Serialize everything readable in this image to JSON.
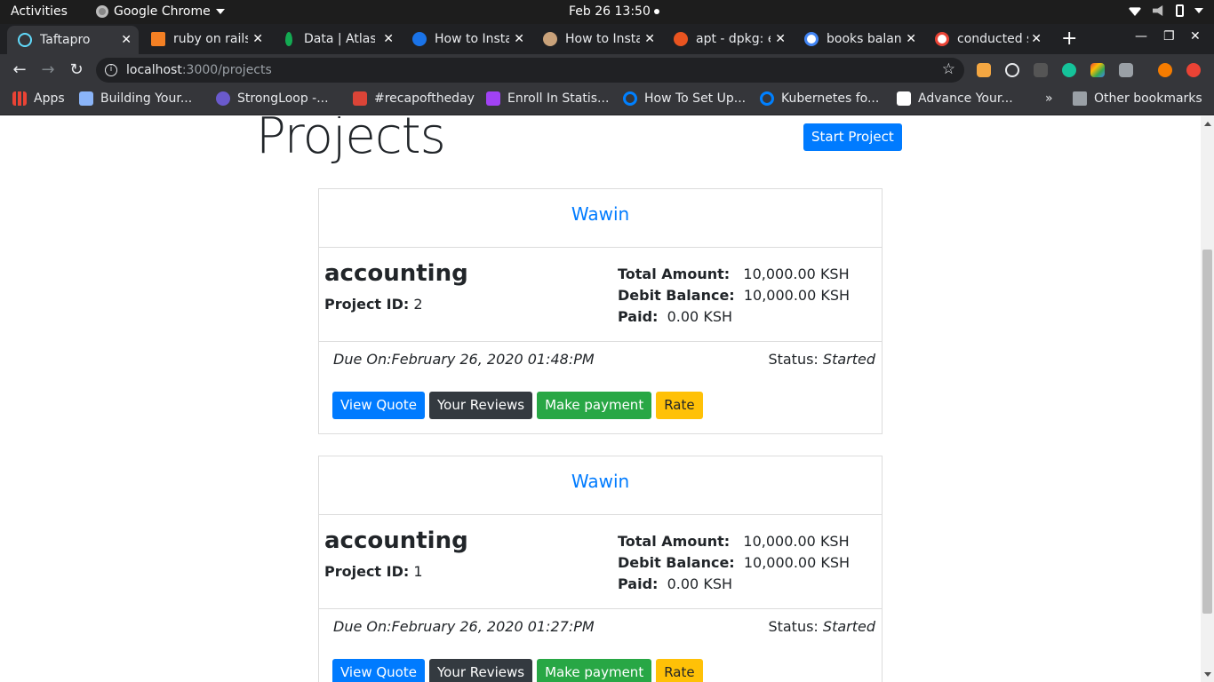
{
  "system_bar": {
    "activities": "Activities",
    "app_name": "Google Chrome",
    "clock": "Feb 26  13:50"
  },
  "tabs": [
    {
      "label": "Taftapro",
      "color": "#61dafb",
      "active": true
    },
    {
      "label": "ruby on rails",
      "color": "#f48024"
    },
    {
      "label": "Data | Atlas",
      "color": "#13aa52"
    },
    {
      "label": "How to Insta",
      "color": "#1a73e8"
    },
    {
      "label": "How to Insta",
      "color": "#c9a27a"
    },
    {
      "label": "apt - dpkg: e",
      "color": "#e95420"
    },
    {
      "label": "books balan",
      "color": "#ffffff"
    },
    {
      "label": "conducted s",
      "color": "#ffffff"
    }
  ],
  "toolbar": {
    "url_host": "localhost",
    "url_path": ":3000/projects"
  },
  "bookmarks": {
    "apps": "Apps",
    "items": [
      {
        "label": "Building Your...",
        "color": "#8ab4f8"
      },
      {
        "label": "StrongLoop -...",
        "color": "#6a5acd"
      },
      {
        "label": "#recapoftheday",
        "color": "#db4437"
      },
      {
        "label": "Enroll In Statis...",
        "color": "#a142f4"
      },
      {
        "label": "How To Set Up...",
        "color": "#0080ff"
      },
      {
        "label": "Kubernetes fo...",
        "color": "#0080ff"
      },
      {
        "label": "Advance Your...",
        "color": "#ffffff"
      }
    ],
    "more": "»",
    "other": "Other bookmarks"
  },
  "page": {
    "title": "Projects",
    "start_button": "Start Project",
    "projects": [
      {
        "client": "Wawin",
        "category": "accounting",
        "project_id_label": "Project ID:",
        "project_id": "2",
        "total_label": "Total Amount:",
        "total": "10,000.00 KSH",
        "debit_label": "Debit Balance:",
        "debit": "10,000.00 KSH",
        "paid_label": "Paid:",
        "paid": "0.00 KSH",
        "due": "Due On:February 26, 2020 01:48:PM",
        "status_label": "Status:",
        "status": "Started"
      },
      {
        "client": "Wawin",
        "category": "accounting",
        "project_id_label": "Project ID:",
        "project_id": "1",
        "total_label": "Total Amount:",
        "total": "10,000.00 KSH",
        "debit_label": "Debit Balance:",
        "debit": "10,000.00 KSH",
        "paid_label": "Paid:",
        "paid": "0.00 KSH",
        "due": "Due On:February 26, 2020 01:27:PM",
        "status_label": "Status:",
        "status": "Started"
      }
    ],
    "actions": {
      "view_quote": "View Quote",
      "reviews": "Your Reviews",
      "payment": "Make payment",
      "rate": "Rate"
    }
  }
}
